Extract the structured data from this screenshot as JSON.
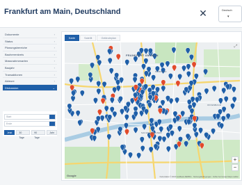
{
  "header": {
    "title": "Frankfurt am Main, Deutschland",
    "close_icon": "close-icon",
    "language": {
      "selected": "Deutsch"
    }
  },
  "sidebar": {
    "items": [
      {
        "label": "Dokumente"
      },
      {
        "label": "Status"
      },
      {
        "label": "Planungsbereiche"
      },
      {
        "label": "Bauherrenkreis"
      },
      {
        "label": "Massnahmenarten"
      },
      {
        "label": "Baujahr"
      },
      {
        "label": "Transaktionen"
      },
      {
        "label": "Akteure"
      },
      {
        "label": "Diskussion"
      }
    ],
    "active_index": 8
  },
  "panel": {
    "from_placeholder": "Start",
    "to_placeholder": "Ende",
    "chips": [
      "Jetzt",
      "30 Tage",
      "90 Tage",
      "Jahr"
    ]
  },
  "map": {
    "tabs": [
      "Karte",
      "Satellit",
      "Geländeplan"
    ],
    "active_tab": 0,
    "labels": {
      "city": "FRANKFURT AM MAIN",
      "north": "NORDEND",
      "sachsen": "SACHSENHAUSEN",
      "offen": "OFFENBACH"
    },
    "zoom_in": "+",
    "zoom_out": "−",
    "google": "Google",
    "attribution": "Kartendaten © 2023 GeoBasis-DE/BKG · Nutzungsbedingungen · Fehler bei Google Maps melden",
    "colors": {
      "pin_blue": "#1f5fa8",
      "pin_red": "#e14b2b",
      "water": "#a9cce3",
      "park": "#c8e6c0",
      "road": "#f6d66e"
    }
  }
}
